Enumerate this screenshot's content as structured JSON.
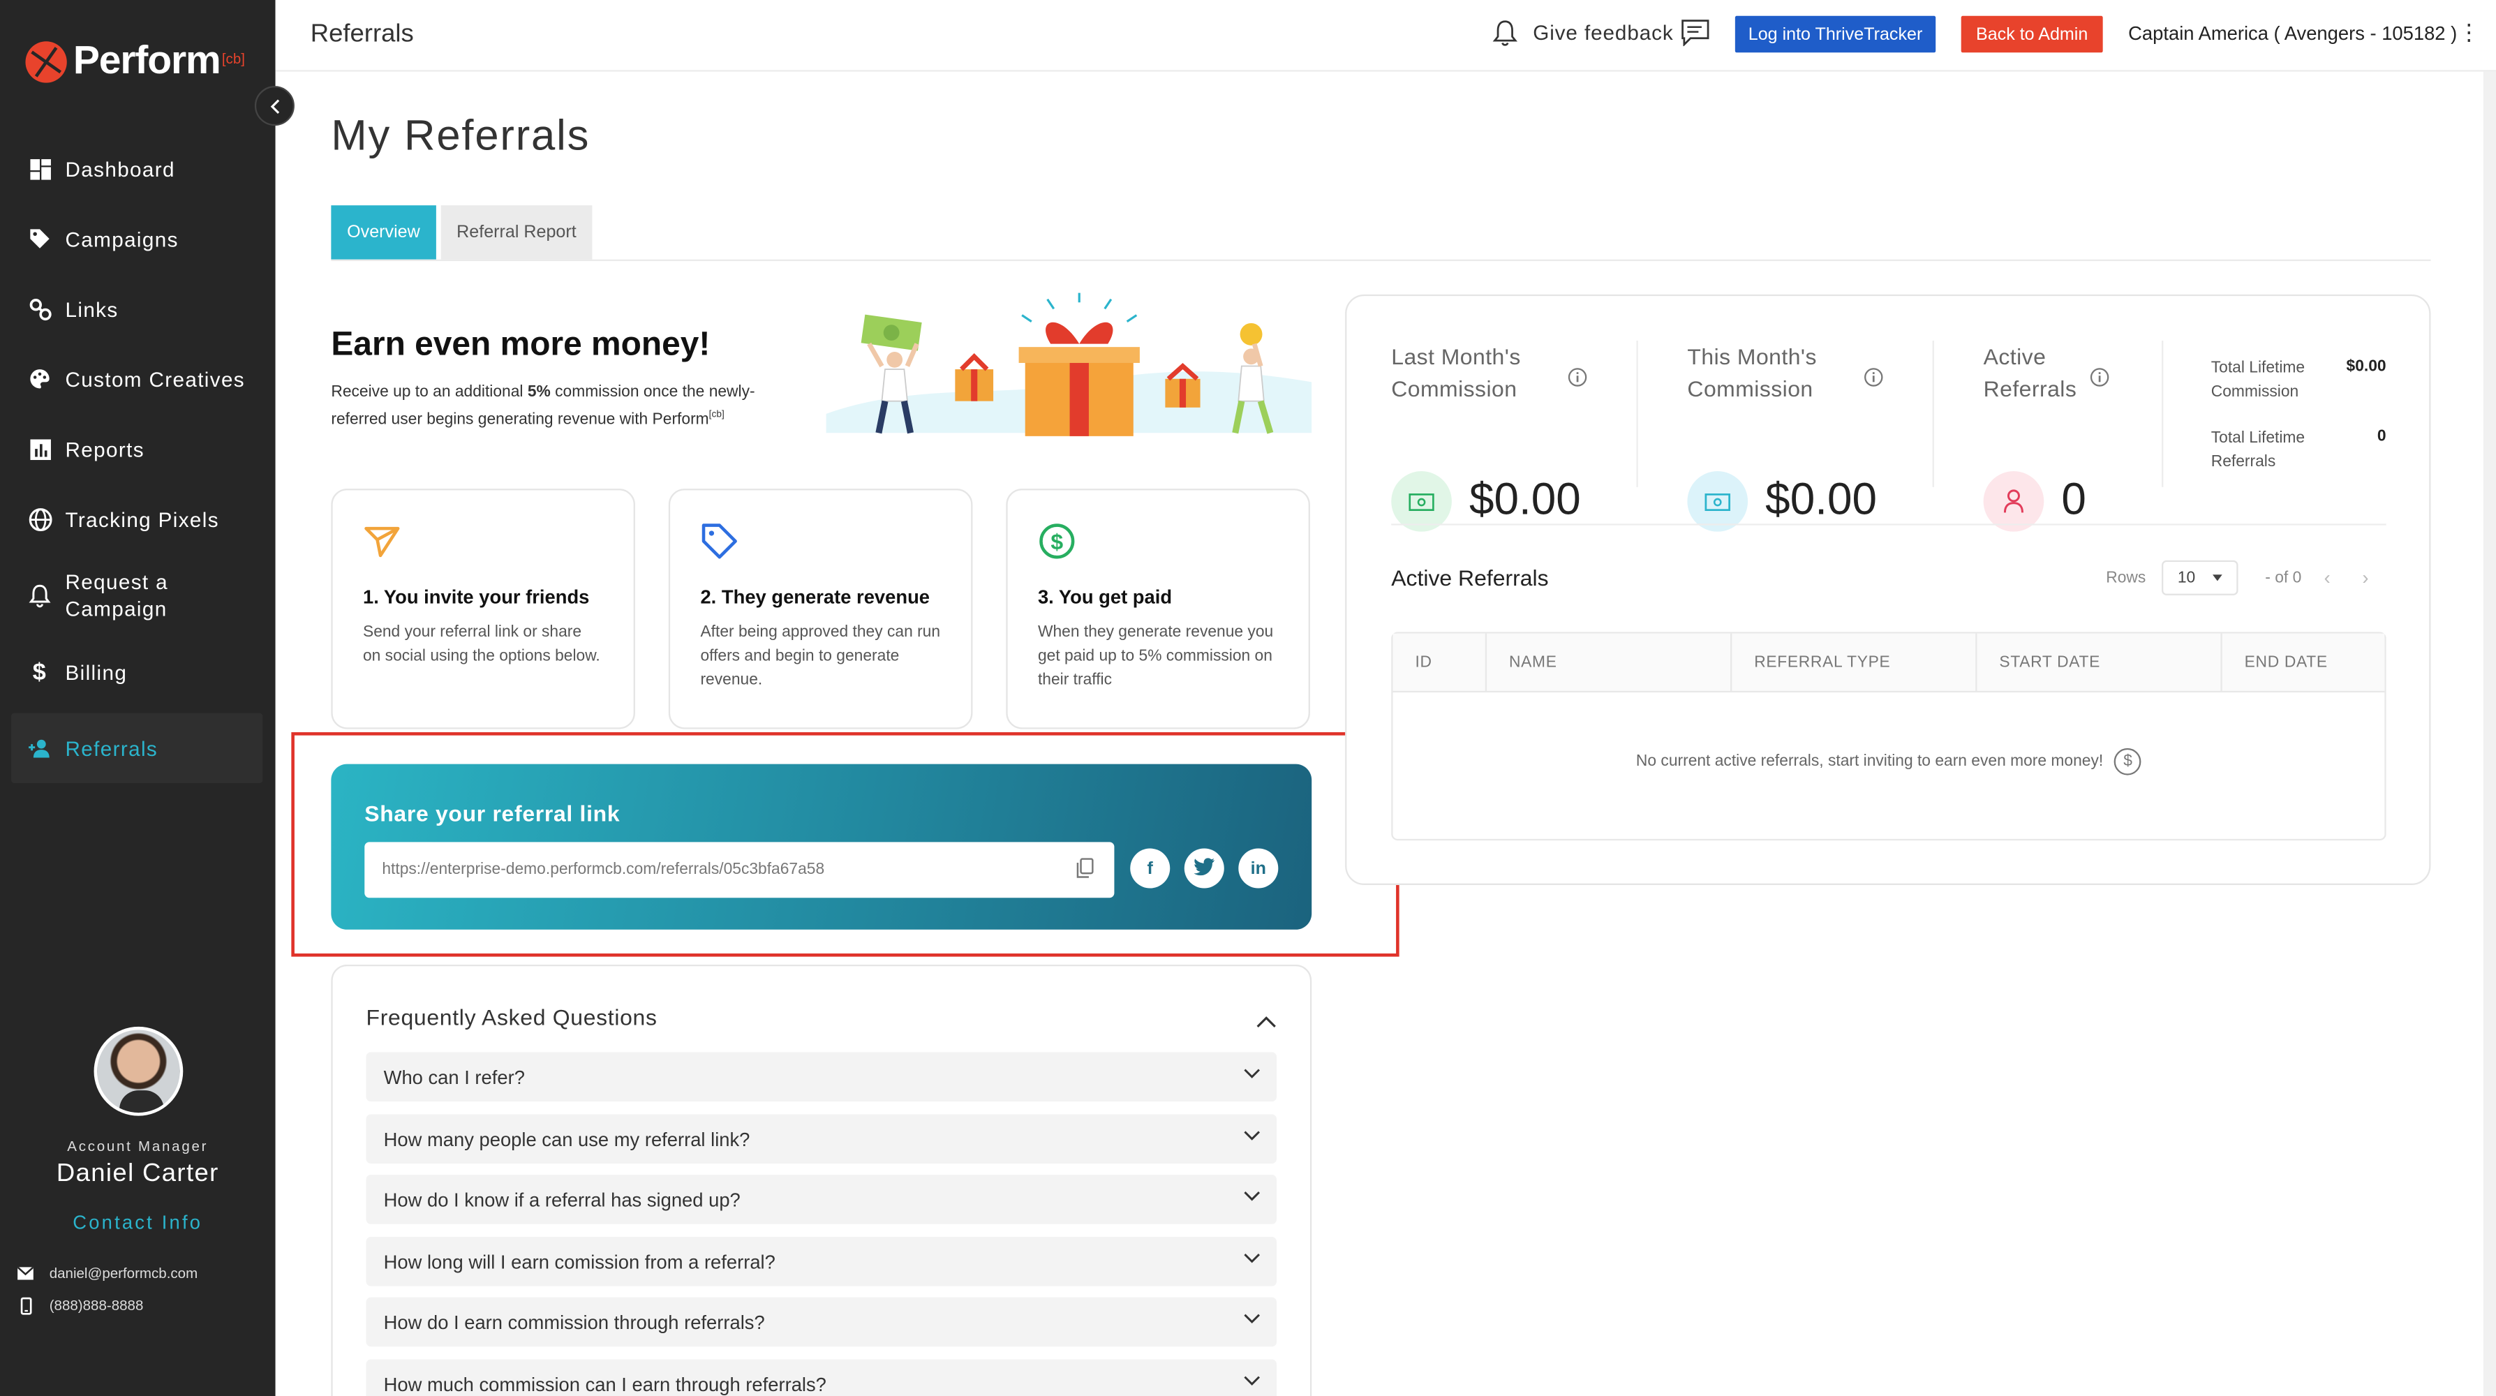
{
  "brand": {
    "name": "Perform",
    "suffix": "[cb]"
  },
  "sidebar": {
    "items": [
      {
        "label": "Dashboard",
        "icon": "dashboard-icon"
      },
      {
        "label": "Campaigns",
        "icon": "tag-icon"
      },
      {
        "label": "Links",
        "icon": "link-icon"
      },
      {
        "label": "Custom Creatives",
        "icon": "palette-icon"
      },
      {
        "label": "Reports",
        "icon": "bar-chart-icon"
      },
      {
        "label": "Tracking Pixels",
        "icon": "globe-icon"
      },
      {
        "label": "Request a Campaign",
        "icon": "bell-icon"
      },
      {
        "label": "Billing",
        "icon": "dollar-icon"
      },
      {
        "label": "Referrals",
        "icon": "user-plus-icon",
        "active": true
      }
    ],
    "account": {
      "role": "Account Manager",
      "name": "Daniel Carter",
      "contact_label": "Contact Info",
      "email": "daniel@performcb.com",
      "phone": "(888)888-8888"
    }
  },
  "header": {
    "title": "Referrals",
    "feedback_label": "Give feedback",
    "thrive_button": "Log into ThriveTracker",
    "admin_button": "Back to Admin",
    "user": "Captain America ( Avengers - 105182 )"
  },
  "page": {
    "title": "My Referrals",
    "tabs": [
      {
        "label": "Overview",
        "active": true
      },
      {
        "label": "Referral Report",
        "active": false
      }
    ]
  },
  "promo": {
    "title": "Earn even more money!",
    "desc_pre": "Receive up to an additional ",
    "desc_bold": "5%",
    "desc_post": " commission once the newly-referred user begins generating revenue with Perform",
    "desc_sup": "[cb]"
  },
  "steps": [
    {
      "title": "1. You invite your friends",
      "desc": "Send your referral link or share on social using the options below.",
      "icon": "send-icon"
    },
    {
      "title": "2. They generate revenue",
      "desc": "After being approved they can run offers and begin to generate revenue.",
      "icon": "tag-icon"
    },
    {
      "title": "3. You get paid",
      "desc": "When they generate revenue you get paid up to 5% commission on their traffic",
      "icon": "dollar-circle-icon"
    }
  ],
  "share": {
    "title": "Share your referral link",
    "url": "https://enterprise-demo.performcb.com/referrals/05c3bfa67a58",
    "social": [
      "f",
      "t",
      "in"
    ]
  },
  "faq": {
    "title": "Frequently Asked Questions",
    "items": [
      "Who can I refer?",
      "How many people can use my referral link?",
      "How do I know if a referral has signed up?",
      "How long will I earn comission from a referral?",
      "How do I earn commission through referrals?",
      "How much commission can I earn through referrals?"
    ]
  },
  "stats": {
    "last_month": {
      "label": "Last Month's Commission",
      "value": "$0.00"
    },
    "this_month": {
      "label": "This Month's Commission",
      "value": "$0.00"
    },
    "active": {
      "label": "Active Referrals",
      "value": "0"
    },
    "lifetime_commission": {
      "label": "Total Lifetime Commission",
      "value": "$0.00"
    },
    "lifetime_referrals": {
      "label": "Total Lifetime Referrals",
      "value": "0"
    }
  },
  "active_referrals": {
    "title": "Active Referrals",
    "rows_label": "Rows",
    "rows_value": "10",
    "page_info": "- of 0",
    "columns": [
      "ID",
      "NAME",
      "REFERRAL TYPE",
      "START DATE",
      "END DATE"
    ],
    "empty_text": "No current active referrals, start inviting to earn even more money!"
  },
  "colors": {
    "accent": "#2bb4cc",
    "brand_red": "#e8432c",
    "thrive_blue": "#1f5dc9",
    "sidebar_bg": "#262626"
  }
}
